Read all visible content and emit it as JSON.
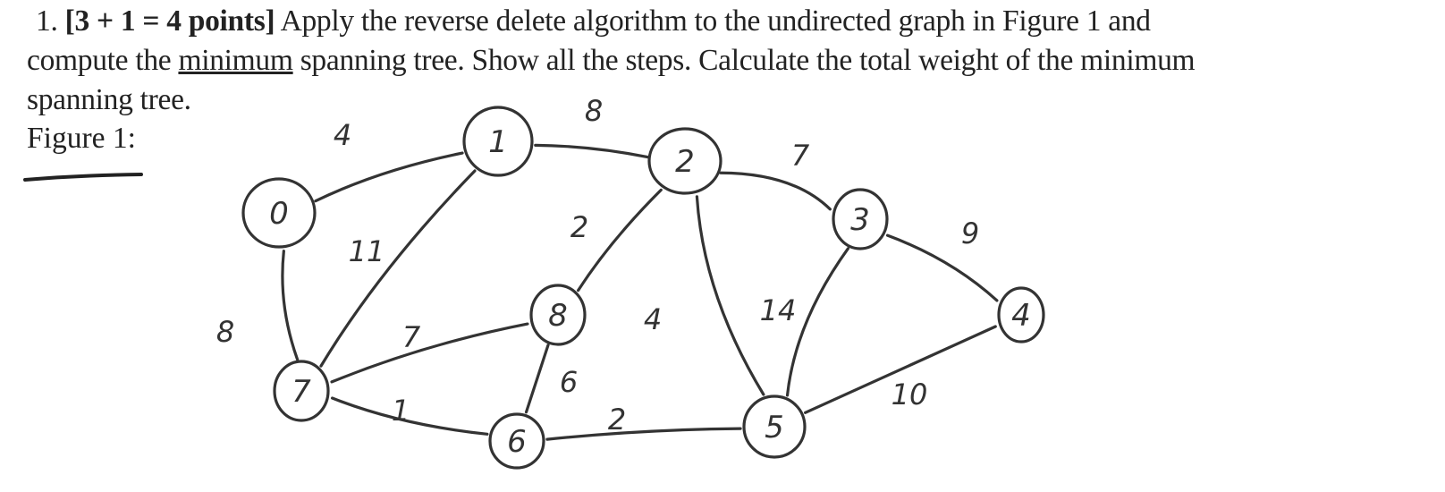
{
  "problem": {
    "number": "1.",
    "points": "[3 + 1 = 4 points]",
    "text_line1": " Apply the reverse delete algorithm to the undirected graph in Figure 1 and",
    "text_line2a": "compute the ",
    "text_line2_underlined": "minimum",
    "text_line2b": " spanning tree. Show all the steps. Calculate the total weight of the minimum",
    "text_line3": "spanning tree.",
    "figure_label": "Figure 1:"
  },
  "graph": {
    "type": "undirected-weighted",
    "nodes": [
      {
        "id": "0",
        "label": "0"
      },
      {
        "id": "1",
        "label": "1"
      },
      {
        "id": "2",
        "label": "2"
      },
      {
        "id": "3",
        "label": "3"
      },
      {
        "id": "4",
        "label": "4"
      },
      {
        "id": "5",
        "label": "5"
      },
      {
        "id": "6",
        "label": "6"
      },
      {
        "id": "7",
        "label": "7"
      },
      {
        "id": "8",
        "label": "8"
      }
    ],
    "edges": [
      {
        "from": "0",
        "to": "1",
        "weight": "4"
      },
      {
        "from": "1",
        "to": "2",
        "weight": "8"
      },
      {
        "from": "2",
        "to": "3",
        "weight": "7"
      },
      {
        "from": "3",
        "to": "4",
        "weight": "9"
      },
      {
        "from": "0",
        "to": "7",
        "weight": "8"
      },
      {
        "from": "1",
        "to": "7",
        "weight": "11"
      },
      {
        "from": "2",
        "to": "8",
        "weight": "2"
      },
      {
        "from": "2",
        "to": "5",
        "weight": "4"
      },
      {
        "from": "7",
        "to": "8",
        "weight": "7"
      },
      {
        "from": "8",
        "to": "6",
        "weight": "6"
      },
      {
        "from": "7",
        "to": "6",
        "weight": "1"
      },
      {
        "from": "6",
        "to": "5",
        "weight": "2"
      },
      {
        "from": "3",
        "to": "5",
        "weight": "14"
      },
      {
        "from": "5",
        "to": "4",
        "weight": "10"
      }
    ]
  }
}
